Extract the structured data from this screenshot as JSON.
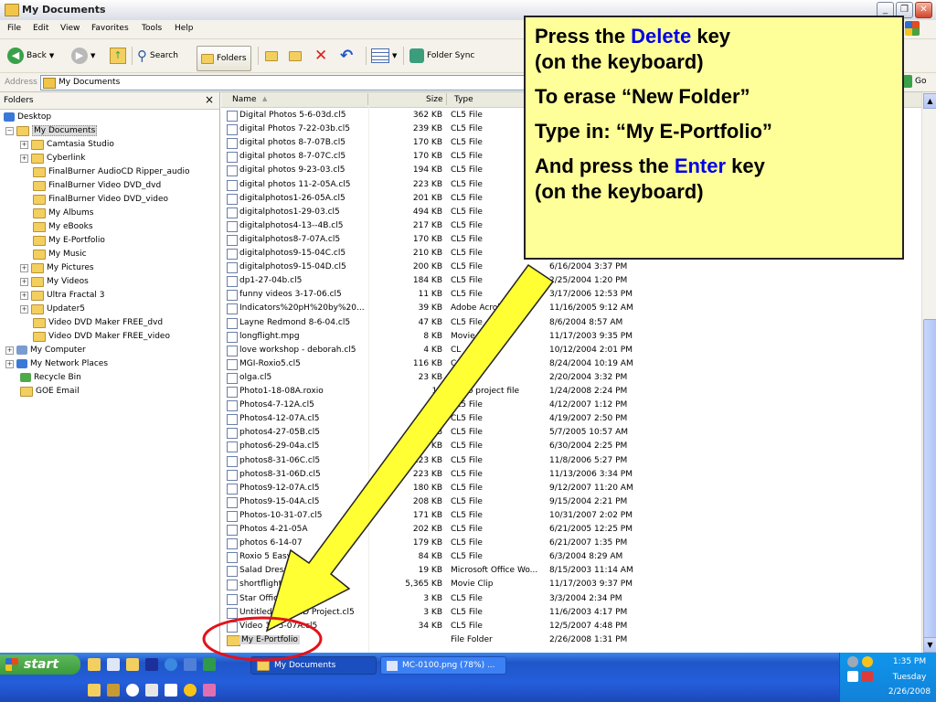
{
  "window": {
    "title": "My Documents"
  },
  "menu": [
    "File",
    "Edit",
    "View",
    "Favorites",
    "Tools",
    "Help"
  ],
  "toolbar": {
    "back": "Back",
    "search": "Search",
    "folders": "Folders",
    "folder_sync": "Folder Sync"
  },
  "address": {
    "label": "Address",
    "value": "My Documents",
    "go": "Go"
  },
  "left_pane": {
    "title": "Folders",
    "close": "×",
    "tree": [
      {
        "label": "Desktop"
      },
      {
        "label": "My Documents"
      },
      {
        "label": "Camtasia Studio"
      },
      {
        "label": "Cyberlink"
      },
      {
        "label": "FinalBurner AudioCD Ripper_audio"
      },
      {
        "label": "FinalBurner Video DVD_dvd"
      },
      {
        "label": "FinalBurner Video DVD_video"
      },
      {
        "label": "My Albums"
      },
      {
        "label": "My eBooks"
      },
      {
        "label": "My E-Portfolio"
      },
      {
        "label": "My Music"
      },
      {
        "label": "My Pictures"
      },
      {
        "label": "My Videos"
      },
      {
        "label": "Ultra Fractal 3"
      },
      {
        "label": "Updater5"
      },
      {
        "label": "Video DVD Maker FREE_dvd"
      },
      {
        "label": "Video DVD Maker FREE_video"
      },
      {
        "label": "My Computer"
      },
      {
        "label": "My Network Places"
      },
      {
        "label": "Recycle Bin"
      },
      {
        "label": "GOE Email"
      }
    ]
  },
  "columns": {
    "name": "Name",
    "size": "Size",
    "type": "Type"
  },
  "files": [
    {
      "name": "Digital Photos 5-6-03d.cl5",
      "size": "362 KB",
      "type": "CL5 File",
      "modified": ""
    },
    {
      "name": "digital Photos 7-22-03b.cl5",
      "size": "239 KB",
      "type": "CL5 File",
      "modified": ""
    },
    {
      "name": "digital photos 8-7-07B.cl5",
      "size": "170 KB",
      "type": "CL5 File",
      "modified": ""
    },
    {
      "name": "digital photos 8-7-07C.cl5",
      "size": "170 KB",
      "type": "CL5 File",
      "modified": ""
    },
    {
      "name": "digital photos 9-23-03.cl5",
      "size": "194 KB",
      "type": "CL5 File",
      "modified": ""
    },
    {
      "name": "digital photos 11-2-05A.cl5",
      "size": "223 KB",
      "type": "CL5 File",
      "modified": ""
    },
    {
      "name": "digitalphotos1-26-05A.cl5",
      "size": "201 KB",
      "type": "CL5 File",
      "modified": ""
    },
    {
      "name": "digitalphotos1-29-03.cl5",
      "size": "494 KB",
      "type": "CL5 File",
      "modified": ""
    },
    {
      "name": "digitalphotos4-13--4B.cl5",
      "size": "217 KB",
      "type": "CL5 File",
      "modified": ""
    },
    {
      "name": "digitalphotos8-7-07A.cl5",
      "size": "170 KB",
      "type": "CL5 File",
      "modified": ""
    },
    {
      "name": "digitalphotos9-15-04C.cl5",
      "size": "210 KB",
      "type": "CL5 File",
      "modified": ""
    },
    {
      "name": "digitalphotos9-15-04D.cl5",
      "size": "200 KB",
      "type": "CL5 File",
      "modified": "6/16/2004 3:37 PM"
    },
    {
      "name": "dp1-27-04b.cl5",
      "size": "184 KB",
      "type": "CL5 File",
      "modified": "2/25/2004 1:20 PM"
    },
    {
      "name": "funny videos 3-17-06.cl5",
      "size": "11 KB",
      "type": "CL5 File",
      "modified": "3/17/2006 12:53 PM"
    },
    {
      "name": "Indicators%20pH%20by%20...",
      "size": "39 KB",
      "type": "Adobe Acrob...",
      "modified": "11/16/2005 9:12 AM"
    },
    {
      "name": "Layne Redmond 8-6-04.cl5",
      "size": "47 KB",
      "type": "CL5 File",
      "modified": "8/6/2004 8:57 AM"
    },
    {
      "name": "longflight.mpg",
      "size": "8 KB",
      "type": "Movie",
      "modified": "11/17/2003 9:35 PM"
    },
    {
      "name": "love workshop - deborah.cl5",
      "size": "4 KB",
      "type": "CL",
      "modified": "10/12/2004 2:01 PM"
    },
    {
      "name": "MGI-Roxio5.cl5",
      "size": "116 KB",
      "type": "C",
      "modified": "8/24/2004 10:19 AM"
    },
    {
      "name": "olga.cl5",
      "size": "23 KB",
      "type": "File",
      "modified": "2/20/2004 3:32 PM"
    },
    {
      "name": "Photo1-18-08A.roxio",
      "size": "13",
      "type": "Roxio project file",
      "modified": "1/24/2008 2:24 PM"
    },
    {
      "name": "Photos4-7-12A.cl5",
      "size": "1",
      "type": "CL5 File",
      "modified": "4/12/2007 1:12 PM"
    },
    {
      "name": "Photos4-12-07A.cl5",
      "size": "",
      "type": "CL5 File",
      "modified": "4/19/2007 2:50 PM"
    },
    {
      "name": "photos4-27-05B.cl5",
      "size": "KB",
      "type": "CL5 File",
      "modified": "5/7/2005 10:57 AM"
    },
    {
      "name": "photos6-29-04a.cl5",
      "size": "224 KB",
      "type": "CL5 File",
      "modified": "6/30/2004 2:25 PM"
    },
    {
      "name": "photos8-31-06C.cl5",
      "size": "223 KB",
      "type": "CL5 File",
      "modified": "11/8/2006 5:27 PM"
    },
    {
      "name": "photos8-31-06D.cl5",
      "size": "223 KB",
      "type": "CL5 File",
      "modified": "11/13/2006 3:34 PM"
    },
    {
      "name": "Photos9-12-07A.cl5",
      "size": "180 KB",
      "type": "CL5 File",
      "modified": "9/12/2007 11:20 AM"
    },
    {
      "name": "Photos9-15-04A.cl5",
      "size": "208 KB",
      "type": "CL5 File",
      "modified": "9/15/2004 2:21 PM"
    },
    {
      "name": "Photos-10-31-07.cl5",
      "size": "171 KB",
      "type": "CL5 File",
      "modified": "10/31/2007 2:02 PM"
    },
    {
      "name": "Photos 4-21-05A",
      "size": "202 KB",
      "type": "CL5 File",
      "modified": "6/21/2005 12:25 PM"
    },
    {
      "name": "photos 6-14-07",
      "size": "179 KB",
      "type": "CL5 File",
      "modified": "6/21/2007 1:35 PM"
    },
    {
      "name": "Roxio 5 Easy",
      "size": "84 KB",
      "type": "CL5 File",
      "modified": "6/3/2004 8:29 AM"
    },
    {
      "name": "Salad Dressin",
      "size": "19 KB",
      "type": "Microsoft Office Wo...",
      "modified": "8/15/2003 11:14 AM"
    },
    {
      "name": "shortflight.m",
      "size": "5,365 KB",
      "type": "Movie Clip",
      "modified": "11/17/2003 9:37 PM"
    },
    {
      "name": "Star Office 7.cl5",
      "size": "3 KB",
      "type": "CL5 File",
      "modified": "3/3/2004 2:34 PM"
    },
    {
      "name": "Untitled Data CD Project.cl5",
      "size": "3 KB",
      "type": "CL5 File",
      "modified": "11/6/2003 4:17 PM"
    },
    {
      "name": "Video 12-5-07A.cl5",
      "size": "34 KB",
      "type": "CL5 File",
      "modified": "12/5/2007 4:48 PM"
    },
    {
      "name": "My E-Portfolio",
      "size": "",
      "type": "File Folder",
      "modified": "2/26/2008 1:31 PM"
    }
  ],
  "callout": {
    "l1a": "Press the ",
    "l1b": "Delete",
    "l1c": " key",
    "l2": "(on the keyboard)",
    "l3": "To erase “New Folder”",
    "l4": "Type in: “My E-Portfolio”",
    "l5a": "And press the ",
    "l5b": "Enter",
    "l5c": " key",
    "l6": "(on the keyboard)"
  },
  "taskbar": {
    "start": "start",
    "tasks": [
      "My Documents",
      "MC-0100.png (78%) ..."
    ],
    "time": "1:35 PM",
    "day": "Tuesday",
    "date": "2/26/2008"
  },
  "colors": {
    "callout_bg": "#ffff99",
    "highlight": "#0000e6",
    "arrow": "#ffff33",
    "circle": "#e3121b"
  }
}
